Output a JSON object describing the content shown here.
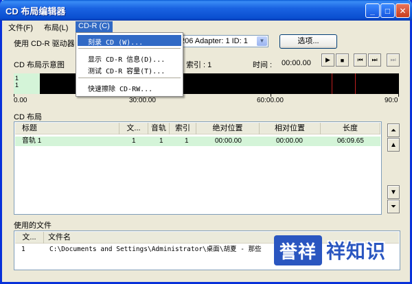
{
  "window": {
    "title": "CD 布局编辑器"
  },
  "titlebar_buttons": {
    "minimize": "_",
    "maximize": "□",
    "close": "✕"
  },
  "menubar": [
    {
      "label": "文件(F)"
    },
    {
      "label": "布局(L)"
    },
    {
      "label": "CD-R (C)"
    }
  ],
  "cdr_menu": {
    "items": [
      {
        "label": "刻录 CD (W)..."
      },
      {
        "label": "显示 CD-R 信息(D)..."
      },
      {
        "label": "测试 CD-R 容量(T)..."
      },
      {
        "label": "快速擦除 CD-RW..."
      }
    ]
  },
  "drive": {
    "label": "使用 CD-R 驱动器",
    "value": "206  Adapter: 1  ID: 1",
    "options_button": "选项..."
  },
  "layout_diagram": {
    "label": "CD 布局示意图",
    "index_label": "索引 : 1",
    "time_label": "时间 :",
    "time_value": "00:00.00",
    "track_lines": [
      "1",
      "1"
    ],
    "ruler_labels": [
      "0.00",
      "30:00.00",
      "60:00.00",
      "90:0"
    ]
  },
  "transport": {
    "play": "▶",
    "stop": "■",
    "prev": "⏮",
    "next": "⏭",
    "end": "⏭"
  },
  "cd_layout": {
    "label": "CD 布局",
    "columns": [
      "标题",
      "文...",
      "音轨",
      "索引",
      "绝对位置",
      "相对位置",
      "长度"
    ],
    "rows": [
      {
        "title": "音轨 1",
        "file": "1",
        "track": "1",
        "index": "1",
        "abs": "00:00.00",
        "rel": "00:00.00",
        "length": "06:09.65"
      }
    ],
    "side_buttons": [
      "⏶",
      "▲",
      "▼",
      "⏷"
    ]
  },
  "used_files": {
    "label": "使用的文件",
    "columns": [
      "文...",
      "文件名"
    ],
    "rows": [
      {
        "num": "1",
        "name": "C:\\Documents and Settings\\Administrator\\桌面\\胡夏 - 那些"
      }
    ]
  },
  "watermark": {
    "logo": "誉祥",
    "text": "祥知识"
  }
}
